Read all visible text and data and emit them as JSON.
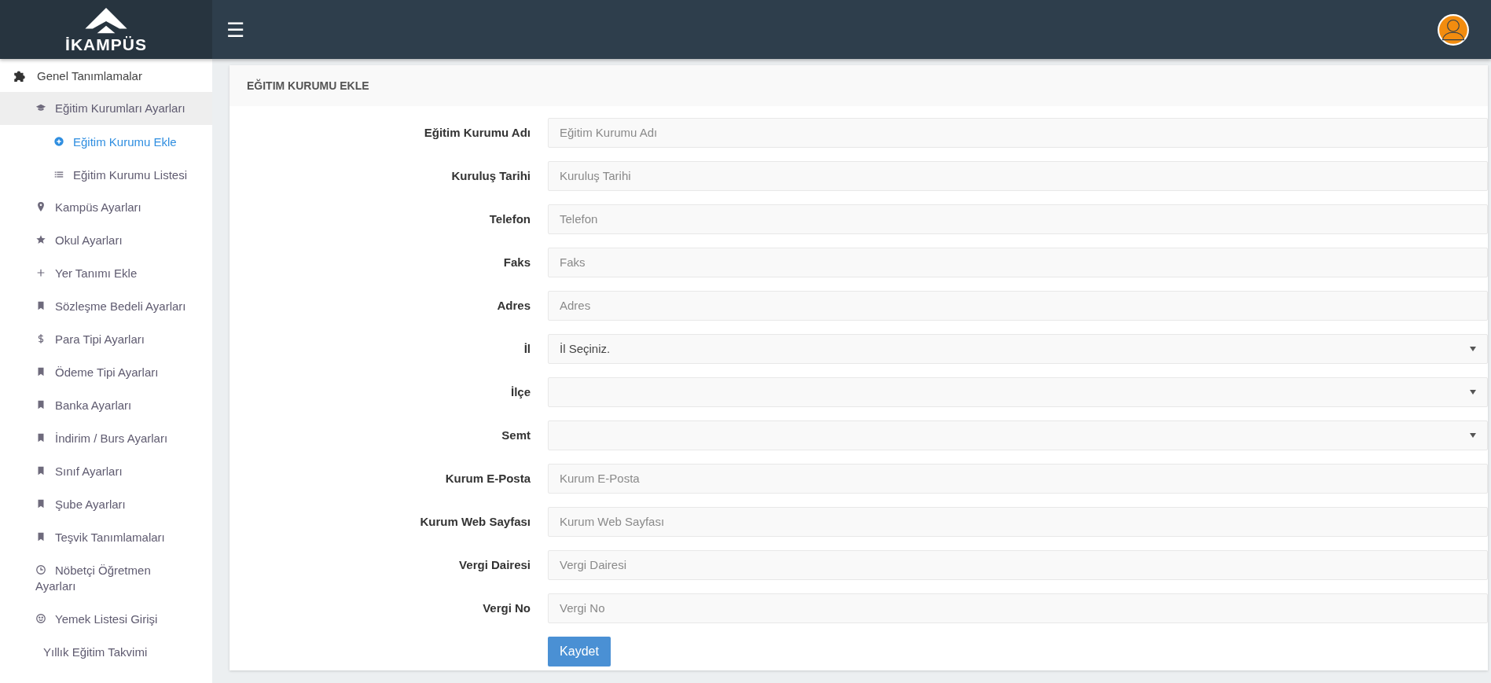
{
  "header": {
    "logo_text": "İKAMPÜS",
    "menu_glyph": "☰"
  },
  "sidebar": {
    "items": [
      {
        "label": "Genel Tanımlamalar",
        "selected": false,
        "children": [
          {
            "label": "Eğitim Kurumları Ayarları",
            "selected": false,
            "expanded": true,
            "children": [
              {
                "label": "Eğitim Kurumu Ekle",
                "selected": true
              },
              {
                "label": "Eğitim Kurumu Listesi",
                "selected": false
              }
            ]
          },
          {
            "label": "Kampüs Ayarları",
            "selected": false
          },
          {
            "label": "Okul Ayarları",
            "selected": false
          },
          {
            "label": "Yer Tanımı Ekle",
            "selected": false
          },
          {
            "label": "Sözleşme Bedeli Ayarları",
            "selected": false
          },
          {
            "label": "Para Tipi Ayarları",
            "selected": false
          },
          {
            "label": "Ödeme Tipi Ayarları",
            "selected": false
          },
          {
            "label": "Banka Ayarları",
            "selected": false
          },
          {
            "label": "İndirim / Burs Ayarları",
            "selected": false
          },
          {
            "label": "Sınıf Ayarları",
            "selected": false
          },
          {
            "label": "Şube Ayarları",
            "selected": false
          },
          {
            "label": "Teşvik Tanımlamaları",
            "selected": false
          },
          {
            "label": "Nöbetçi Öğretmen Ayarları",
            "selected": false
          },
          {
            "label": "Yemek Listesi Girişi",
            "selected": false
          },
          {
            "label": "Yıllık Eğitim Takvimi",
            "selected": false
          }
        ]
      }
    ]
  },
  "panel": {
    "title": "EĞITIM KURUMU EKLE",
    "fields": [
      {
        "kind": "text",
        "label": "Eğitim Kurumu Adı",
        "placeholder": "Eğitim Kurumu Adı"
      },
      {
        "kind": "text",
        "label": "Kuruluş Tarihi",
        "placeholder": "Kuruluş Tarihi"
      },
      {
        "kind": "text",
        "label": "Telefon",
        "placeholder": "Telefon"
      },
      {
        "kind": "text",
        "label": "Faks",
        "placeholder": "Faks"
      },
      {
        "kind": "text",
        "label": "Adres",
        "placeholder": "Adres"
      },
      {
        "kind": "select",
        "label": "İl",
        "value": "İl Seçiniz."
      },
      {
        "kind": "select",
        "label": "İlçe"
      },
      {
        "kind": "select",
        "label": "Semt"
      },
      {
        "kind": "text",
        "label": "Kurum E-Posta",
        "placeholder": "Kurum E-Posta"
      },
      {
        "kind": "text",
        "label": "Kurum Web Sayfası",
        "placeholder": "Kurum Web Sayfası"
      },
      {
        "kind": "text",
        "label": "Vergi Dairesi",
        "placeholder": "Vergi Dairesi"
      },
      {
        "kind": "text",
        "label": "Vergi No",
        "placeholder": "Vergi No"
      }
    ],
    "submit": "Kaydet"
  }
}
